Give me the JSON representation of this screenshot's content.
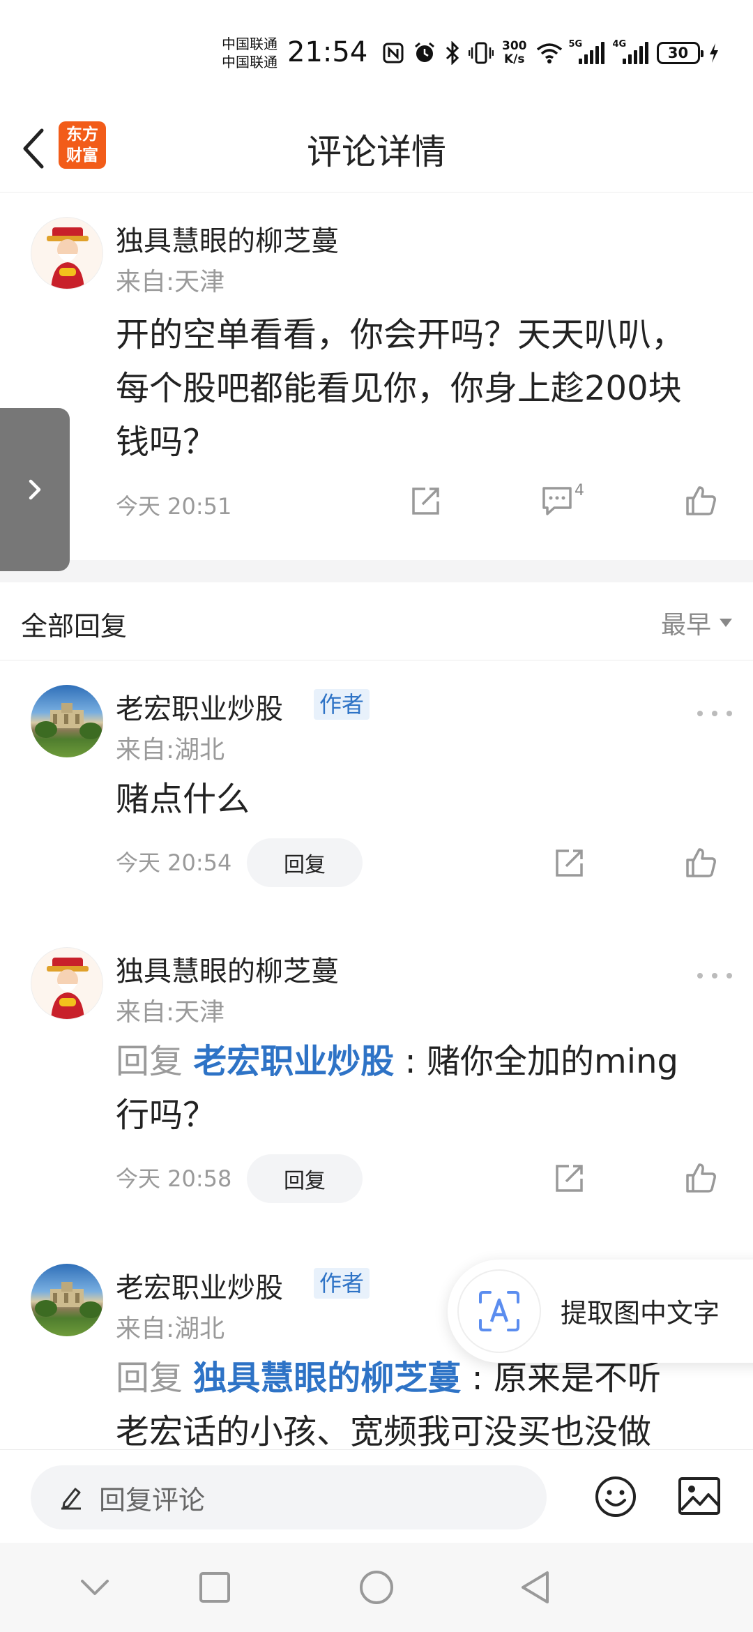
{
  "status_bar": {
    "carrier_1": "中国联通",
    "carrier_2": "中国联通",
    "time": "21:54",
    "net_speed_value": "300",
    "net_speed_unit": "K/s",
    "signal_1_tag": "5G",
    "signal_2_tag": "4G",
    "battery": "30",
    "icons": [
      "nfc-icon",
      "alarm-icon",
      "bluetooth-icon",
      "vibrate-icon",
      "wifi-icon",
      "signal-icon",
      "battery-icon",
      "charging-icon"
    ]
  },
  "header": {
    "logo_line1": "东方",
    "logo_line2": "财富",
    "title": "评论详情"
  },
  "main_comment": {
    "username": "独具慧眼的柳芝蔓",
    "location": "来自:天津",
    "content_line1": "开的空单看看，你会开吗？天天叭叭，",
    "content_line2": "每个股吧都能看见你，你身上趁200块",
    "content_line3": "钱吗？",
    "time": "今天 20:51",
    "comment_count": "4"
  },
  "replies_section": {
    "title": "全部回复",
    "sort": "最早"
  },
  "replies": [
    {
      "username": "老宏职业炒股",
      "badge": "作者",
      "location": "来自:湖北",
      "content": "赌点什么",
      "time": "今天 20:54",
      "reply_label": "回复"
    },
    {
      "username": "独具慧眼的柳芝蔓",
      "location": "来自:天津",
      "prefix": "回复",
      "mention": "老宏职业炒股",
      "content_line1": " : 赌你全加的ming",
      "content_line2": "行吗？",
      "time": "今天 20:58",
      "reply_label": "回复"
    },
    {
      "username": "老宏职业炒股",
      "badge": "作者",
      "location": "来自:湖北",
      "prefix": "回复",
      "mention": "独具慧眼的柳芝蔓",
      "content_line1": " : 原来是不听",
      "content_line2": "老宏话的小孩、宽频我可没买也没做"
    }
  ],
  "ocr_float": {
    "label": "提取图中文字"
  },
  "bottom_bar": {
    "input_placeholder": "回复评论"
  },
  "colors": {
    "brand": "#f25c19",
    "link": "#2e73c6",
    "muted": "#9a9a9a"
  }
}
